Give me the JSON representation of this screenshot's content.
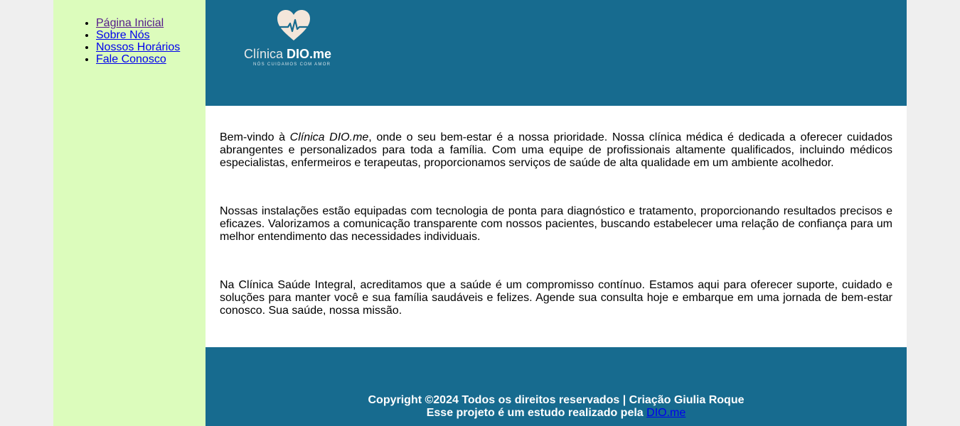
{
  "nav": {
    "items": [
      {
        "label": "Página Inicial"
      },
      {
        "label": "Sobre Nós"
      },
      {
        "label": "Nossos Horários"
      },
      {
        "label": "Fale Conosco"
      }
    ]
  },
  "header": {
    "logo_text_light": "Clínica ",
    "logo_text_bold": "DIO.me",
    "logo_tagline": "NÓS CUIDAMOS COM AMOR",
    "logo_icon": "heart-pulse-icon"
  },
  "content": {
    "p1_before": "Bem-vindo à ",
    "p1_emphasis": "Clínica DIO.me",
    "p1_after": ", onde o seu bem-estar é a nossa prioridade. Nossa clínica médica é dedicada a oferecer cuidados abrangentes e personalizados para toda a família. Com uma equipe de profissionais altamente qualificados, incluindo médicos especialistas, enfermeiros e terapeutas, proporcionamos serviços de saúde de alta qualidade em um ambiente acolhedor.",
    "p2": "Nossas instalações estão equipadas com tecnologia de ponta para diagnóstico e tratamento, proporcionando resultados precisos e eficazes. Valorizamos a comunicação transparente com nossos pacientes, buscando estabelecer uma relação de confiança para um melhor entendimento das necessidades individuais.",
    "p3": "Na Clínica Saúde Integral, acreditamos que a saúde é um compromisso contínuo. Estamos aqui para oferecer suporte, cuidado e soluções para manter você e sua família saudáveis e felizes. Agende sua consulta hoje e embarque em uma jornada de bem-estar conosco. Sua saúde, nossa missão."
  },
  "footer": {
    "copyright": "Copyright ©2024 Todos os direitos reservados | Criação Giulia Roque",
    "study_text": "Esse projeto é um estudo realizado pela ",
    "study_link": "DIO.me"
  },
  "colors": {
    "sidebar_bg": "#dcfcbc",
    "header_bg": "#176b8f",
    "footer_bg": "#176b8f",
    "page_bg": "#efefef",
    "link": "#0000ee",
    "visited_link": "#551a8b"
  }
}
